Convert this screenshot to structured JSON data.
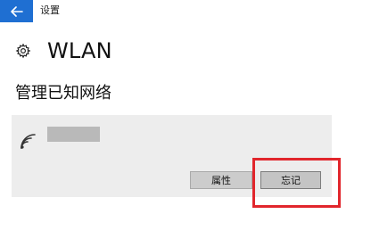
{
  "window": {
    "title": "设置",
    "back_icon": "back-arrow-icon",
    "accent_color": "#1f6fd2"
  },
  "page": {
    "icon": "gear-icon",
    "title": "WLAN"
  },
  "section": {
    "heading": "管理已知网络"
  },
  "network": {
    "icon": "wifi-icon",
    "name_redacted": true,
    "card_color": "#ededed"
  },
  "buttons": {
    "properties_label": "属性",
    "forget_label": "忘记"
  },
  "annotation": {
    "highlight_color": "#e1262c"
  }
}
